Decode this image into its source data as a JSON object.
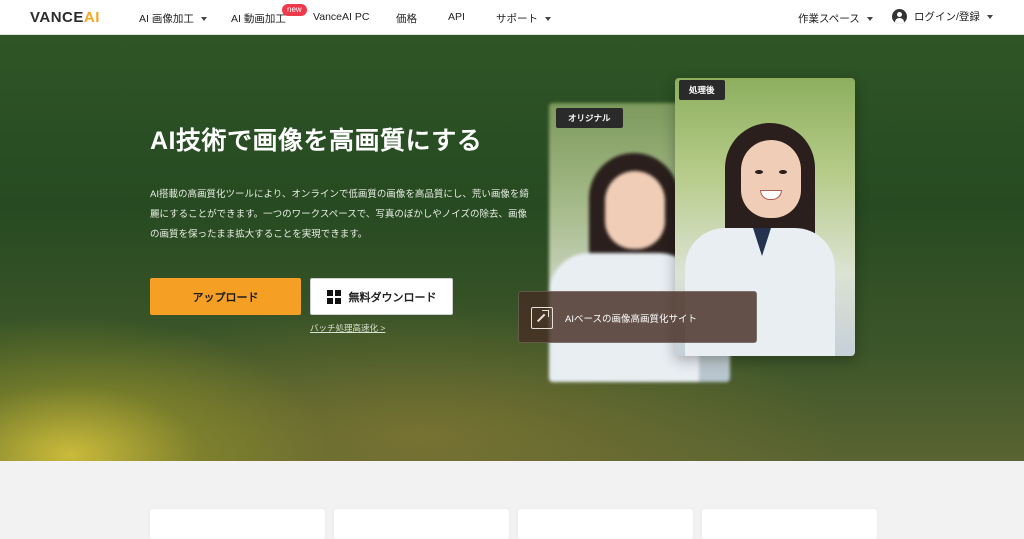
{
  "nav": {
    "logo_main": "VANCE",
    "logo_ai": "AI",
    "items": [
      {
        "label": "AI 画像加工"
      },
      {
        "label": "AI 動画加工"
      },
      {
        "label": "VanceAI PC"
      },
      {
        "label": "価格"
      },
      {
        "label": "API"
      },
      {
        "label": "サポート"
      }
    ],
    "new_badge": "new",
    "workspace": "作業スペース",
    "login": "ログイン/登録"
  },
  "hero": {
    "title": "AI技術で画像を高画質にする",
    "description": "AI搭載の高画質化ツールにより、オンラインで低画質の画像を高品質にし、荒い画像を綺麗にすることができます。一つのワークスペースで、写真のぼかしやノイズの除去、画像の画質を保ったまま拡大することを実現できます。",
    "upload_button": "アップロード",
    "download_button": "無料ダウンロード",
    "batch_link": "バッチ処理高速化 >"
  },
  "preview": {
    "original_label": "オリジナル",
    "after_label": "処理後",
    "overlay_text": "AIベースの画像高画質化サイト"
  },
  "colors": {
    "accent": "#f5a024",
    "badge": "#f0384c",
    "hero_bg": "#2f5526"
  }
}
